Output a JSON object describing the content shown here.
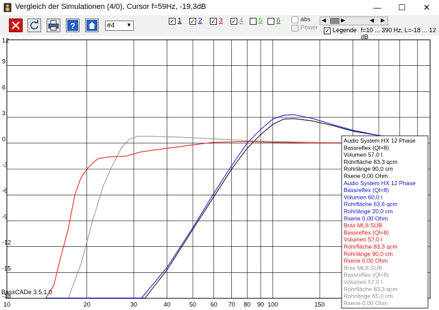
{
  "window": {
    "title": "Vergleich der Simulationen (4/0), Cursor f=59Hz, -19,3dB",
    "minimize": "—",
    "maximize": "☐",
    "close": "✕"
  },
  "toolbar": {
    "combo_value": "#4",
    "checks": [
      {
        "label": "1",
        "color": "#000000",
        "checked": true
      },
      {
        "label": "2",
        "color": "#1010d0",
        "checked": true
      },
      {
        "label": "3",
        "color": "#e01010",
        "checked": true
      },
      {
        "label": "4",
        "color": "#909090",
        "checked": true
      },
      {
        "label": "5",
        "color": "#30c030",
        "checked": false
      },
      {
        "label": "6",
        "color": "#108010",
        "checked": false
      }
    ],
    "abs_label": "abs",
    "power_label": "Power",
    "legend_label": "Legende",
    "range_text": "f=10 ... 390 Hz, L=-18 ... 12 dB"
  },
  "chart_data": {
    "type": "line",
    "x_scale": "log",
    "xlim": [
      10,
      390
    ],
    "ylim": [
      -18,
      12
    ],
    "x_ticks": [
      10,
      20,
      30,
      40,
      50,
      60,
      70,
      80,
      90,
      100,
      150,
      200,
      250,
      300,
      350
    ],
    "y_ticks": [
      12,
      9,
      6,
      3,
      0,
      -3,
      -6,
      -9,
      -12,
      -15,
      -18
    ],
    "grid": true,
    "watermark": "BassCADe 3.5.1.0",
    "series": [
      {
        "name": "Audio System HX 12 Phase",
        "color": "#000000",
        "points": [
          [
            33,
            -18
          ],
          [
            40,
            -14.7
          ],
          [
            50,
            -10
          ],
          [
            60,
            -6.2
          ],
          [
            70,
            -3
          ],
          [
            80,
            -0.6
          ],
          [
            90,
            1
          ],
          [
            100,
            2.2
          ],
          [
            110,
            2.8
          ],
          [
            120,
            2.85
          ],
          [
            140,
            2.6
          ],
          [
            170,
            2
          ],
          [
            200,
            1.4
          ],
          [
            250,
            0.9
          ],
          [
            300,
            0.6
          ]
        ]
      },
      {
        "name": "Audio System HX 12 Phase",
        "color": "#1010d0",
        "points": [
          [
            32,
            -18
          ],
          [
            40,
            -14.4
          ],
          [
            50,
            -9.8
          ],
          [
            60,
            -5.8
          ],
          [
            70,
            -2.6
          ],
          [
            80,
            0
          ],
          [
            90,
            1.6
          ],
          [
            100,
            2.8
          ],
          [
            110,
            3.25
          ],
          [
            120,
            3.3
          ],
          [
            140,
            2.9
          ],
          [
            170,
            2.1
          ],
          [
            200,
            1.5
          ],
          [
            250,
            0.9
          ],
          [
            300,
            0.6
          ]
        ]
      },
      {
        "name": "Brax ML8 SUB",
        "color": "#e01010",
        "points": [
          [
            14,
            -18
          ],
          [
            15,
            -16.5
          ],
          [
            16,
            -13
          ],
          [
            17,
            -10
          ],
          [
            18,
            -6
          ],
          [
            19,
            -4
          ],
          [
            20,
            -3
          ],
          [
            21,
            -2.3
          ],
          [
            22,
            -1.8
          ],
          [
            24,
            -1.6
          ],
          [
            28,
            -1.5
          ],
          [
            32,
            -1
          ],
          [
            40,
            -0.6
          ],
          [
            50,
            -0.2
          ],
          [
            60,
            0.1
          ],
          [
            80,
            0.2
          ],
          [
            100,
            0.1
          ],
          [
            150,
            0
          ],
          [
            200,
            0
          ],
          [
            300,
            0
          ]
        ]
      },
      {
        "name": "Brax ML8 SUB",
        "color": "#909090",
        "points": [
          [
            17,
            -18
          ],
          [
            19,
            -14
          ],
          [
            21,
            -9
          ],
          [
            23,
            -5
          ],
          [
            25,
            -2.5
          ],
          [
            27,
            -0.5
          ],
          [
            29,
            0.5
          ],
          [
            31,
            0.8
          ],
          [
            35,
            0.8
          ],
          [
            45,
            0.7
          ],
          [
            60,
            0.5
          ],
          [
            80,
            0.3
          ],
          [
            100,
            0.2
          ],
          [
            150,
            0.1
          ],
          [
            200,
            0.05
          ],
          [
            300,
            0
          ]
        ]
      }
    ]
  },
  "legend": [
    {
      "color": "#000000",
      "lines": [
        "Audio System HX 12 Phase",
        "Bassreflex (Ql=8)",
        "Volumen 57,0 l",
        "Rohrfläche 83,3 qcm",
        "Rohrlänge 90,0 cm",
        "Rserie 0,00 Ohm"
      ]
    },
    {
      "color": "#1010d0",
      "lines": [
        "Audio System HX 12 Phase",
        "Bassreflex (Ql=8)",
        "Volumen 60,0 l",
        "Rohrfläche 63,6 qcm",
        "Rohrlänge 20,0 cm",
        "Rserie 0,00 Ohm"
      ]
    },
    {
      "color": "#e01010",
      "lines": [
        "Brax ML8 SUB",
        "Bassreflex (Ql=8)",
        "Volumen 57,0 l",
        "Rohrfläche 83,3 qcm",
        "Rohrlänge 90,0 cm",
        "Rserie 0,00 Ohm"
      ]
    },
    {
      "color": "#909090",
      "lines": [
        "Brax ML8 SUB",
        "Bassreflex (Ql=8)",
        "Volumen 57,0 l",
        "Rohrfläche 83,3 qcm",
        "Rohrlänge 65,0 cm",
        "Rserie 0,00 Ohm"
      ]
    }
  ]
}
